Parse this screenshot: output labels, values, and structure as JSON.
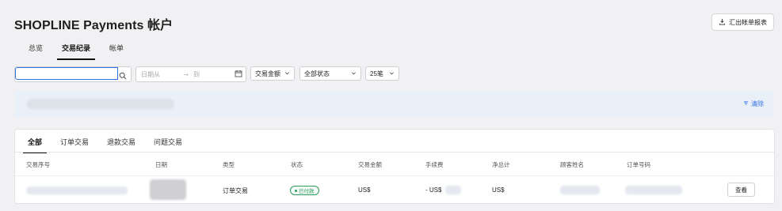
{
  "page": {
    "title": "SHOPLINE Payments 帐户"
  },
  "header": {
    "export_label": "汇出帐单报表"
  },
  "top_tabs": [
    {
      "label": "总览",
      "active": false
    },
    {
      "label": "交易纪录",
      "active": true
    },
    {
      "label": "帐单",
      "active": false
    }
  ],
  "filters": {
    "search_value": "",
    "date_from_placeholder": "日期从",
    "date_to_placeholder": "到",
    "amount_select": "交易金额",
    "status_select": "全部状态",
    "page_size_select": "25笔"
  },
  "info_panel": {
    "clear_label": "清除"
  },
  "sub_tabs": [
    {
      "label": "全部",
      "active": true
    },
    {
      "label": "订单交易",
      "active": false
    },
    {
      "label": "退款交易",
      "active": false
    },
    {
      "label": "问题交易",
      "active": false
    }
  ],
  "table": {
    "headers": [
      "交易序号",
      "日期",
      "类型",
      "状态",
      "交易金额",
      "手续费",
      "净总计",
      "顾客姓名",
      "订单号码"
    ],
    "rows": [
      {
        "type": "订单交易",
        "status": "已付款",
        "amount": "US$",
        "fee": "- US$",
        "net": "US$",
        "action": "查看"
      }
    ]
  },
  "colors": {
    "accent": "#2f6fe6",
    "success": "#2e9b5b",
    "background": "#f1f1f3"
  },
  "icons": [
    "download-icon",
    "search-icon",
    "arrow-right-icon",
    "calendar-icon",
    "chevron-down-icon",
    "filter-clear-icon",
    "status-dot-icon"
  ]
}
